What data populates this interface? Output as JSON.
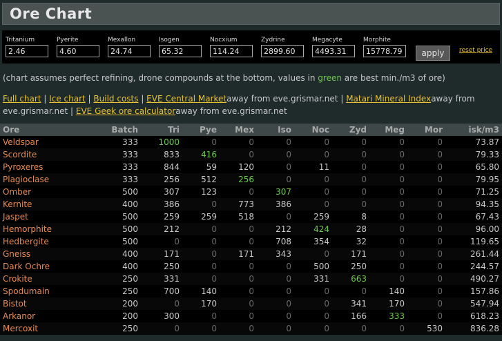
{
  "title": "Ore Chart",
  "prices": [
    {
      "label": "Tritanium",
      "value": "2.46"
    },
    {
      "label": "Pyerite",
      "value": "4.60"
    },
    {
      "label": "Mexallon",
      "value": "24.74"
    },
    {
      "label": "Isogen",
      "value": "65.32"
    },
    {
      "label": "Nocxium",
      "value": "114.24"
    },
    {
      "label": "Zydrine",
      "value": "2899.60"
    },
    {
      "label": "Megacyte",
      "value": "4493.31"
    },
    {
      "label": "Morphite",
      "value": "15778.79"
    }
  ],
  "apply_label": "apply",
  "reset_label": "reset price",
  "note": {
    "before": "(chart assumes perfect refining, drone compounds at the bottom, values in ",
    "green": "green",
    "after": " are best min./m3 of ore)"
  },
  "links": {
    "full_chart": "Full chart",
    "ice_chart": "Ice chart",
    "build_costs": "Build costs",
    "eve_central": "EVE Central Market",
    "away1": "away from eve.grismar.net",
    "matari": "Matari Mineral Index",
    "away2": "away from eve.grismar.net",
    "eve_geek": "EVE Geek ore calculator",
    "away3": "away from eve.grismar.net"
  },
  "table": {
    "headers": [
      "Ore",
      "Batch",
      "Tri",
      "Pye",
      "Mex",
      "Iso",
      "Noc",
      "Zyd",
      "Meg",
      "Mor",
      "isk/m3"
    ],
    "rows": [
      {
        "ore": "Veldspar",
        "batch": "333",
        "m": [
          "1000",
          "0",
          "0",
          "0",
          "0",
          "0",
          "0",
          "0"
        ],
        "best": [
          0
        ],
        "isk": "73.87"
      },
      {
        "ore": "Scordite",
        "batch": "333",
        "m": [
          "833",
          "416",
          "0",
          "0",
          "0",
          "0",
          "0",
          "0"
        ],
        "best": [
          1
        ],
        "isk": "79.33"
      },
      {
        "ore": "Pyroxeres",
        "batch": "333",
        "m": [
          "844",
          "59",
          "120",
          "0",
          "11",
          "0",
          "0",
          "0"
        ],
        "best": [],
        "isk": "65.80"
      },
      {
        "ore": "Plagioclase",
        "batch": "333",
        "m": [
          "256",
          "512",
          "256",
          "0",
          "0",
          "0",
          "0",
          "0"
        ],
        "best": [
          2
        ],
        "isk": "79.95"
      },
      {
        "ore": "Omber",
        "batch": "500",
        "m": [
          "307",
          "123",
          "0",
          "307",
          "0",
          "0",
          "0",
          "0"
        ],
        "best": [
          3
        ],
        "isk": "71.25"
      },
      {
        "ore": "Kernite",
        "batch": "400",
        "m": [
          "386",
          "0",
          "773",
          "386",
          "0",
          "0",
          "0",
          "0"
        ],
        "best": [],
        "isk": "94.35"
      },
      {
        "ore": "Jaspet",
        "batch": "500",
        "m": [
          "259",
          "259",
          "518",
          "0",
          "259",
          "8",
          "0",
          "0"
        ],
        "best": [],
        "isk": "67.43"
      },
      {
        "ore": "Hemorphite",
        "batch": "500",
        "m": [
          "212",
          "0",
          "0",
          "212",
          "424",
          "28",
          "0",
          "0"
        ],
        "best": [
          4
        ],
        "isk": "96.00"
      },
      {
        "ore": "Hedbergite",
        "batch": "500",
        "m": [
          "0",
          "0",
          "0",
          "708",
          "354",
          "32",
          "0",
          "0"
        ],
        "best": [],
        "isk": "119.65"
      },
      {
        "ore": "Gneiss",
        "batch": "400",
        "m": [
          "171",
          "0",
          "171",
          "343",
          "0",
          "171",
          "0",
          "0"
        ],
        "best": [],
        "isk": "261.44"
      },
      {
        "ore": "Dark Ochre",
        "batch": "400",
        "m": [
          "250",
          "0",
          "0",
          "0",
          "500",
          "250",
          "0",
          "0"
        ],
        "best": [],
        "isk": "244.57"
      },
      {
        "ore": "Crokite",
        "batch": "250",
        "m": [
          "331",
          "0",
          "0",
          "0",
          "331",
          "663",
          "0",
          "0"
        ],
        "best": [
          5
        ],
        "isk": "490.27"
      },
      {
        "ore": "Spodumain",
        "batch": "250",
        "m": [
          "700",
          "140",
          "0",
          "0",
          "0",
          "0",
          "140",
          "0"
        ],
        "best": [],
        "isk": "157.86"
      },
      {
        "ore": "Bistot",
        "batch": "200",
        "m": [
          "0",
          "170",
          "0",
          "0",
          "0",
          "341",
          "170",
          "0"
        ],
        "best": [],
        "isk": "547.94"
      },
      {
        "ore": "Arkanor",
        "batch": "200",
        "m": [
          "300",
          "0",
          "0",
          "0",
          "0",
          "166",
          "333",
          "0"
        ],
        "best": [
          6
        ],
        "isk": "618.23"
      },
      {
        "ore": "Mercoxit",
        "batch": "250",
        "m": [
          "0",
          "0",
          "0",
          "0",
          "0",
          "0",
          "0",
          "530"
        ],
        "best": [],
        "isk": "836.28"
      }
    ]
  },
  "colors": {
    "best": "#6cc84c",
    "ore_name": "#e88a50",
    "link": "#e8c030"
  }
}
